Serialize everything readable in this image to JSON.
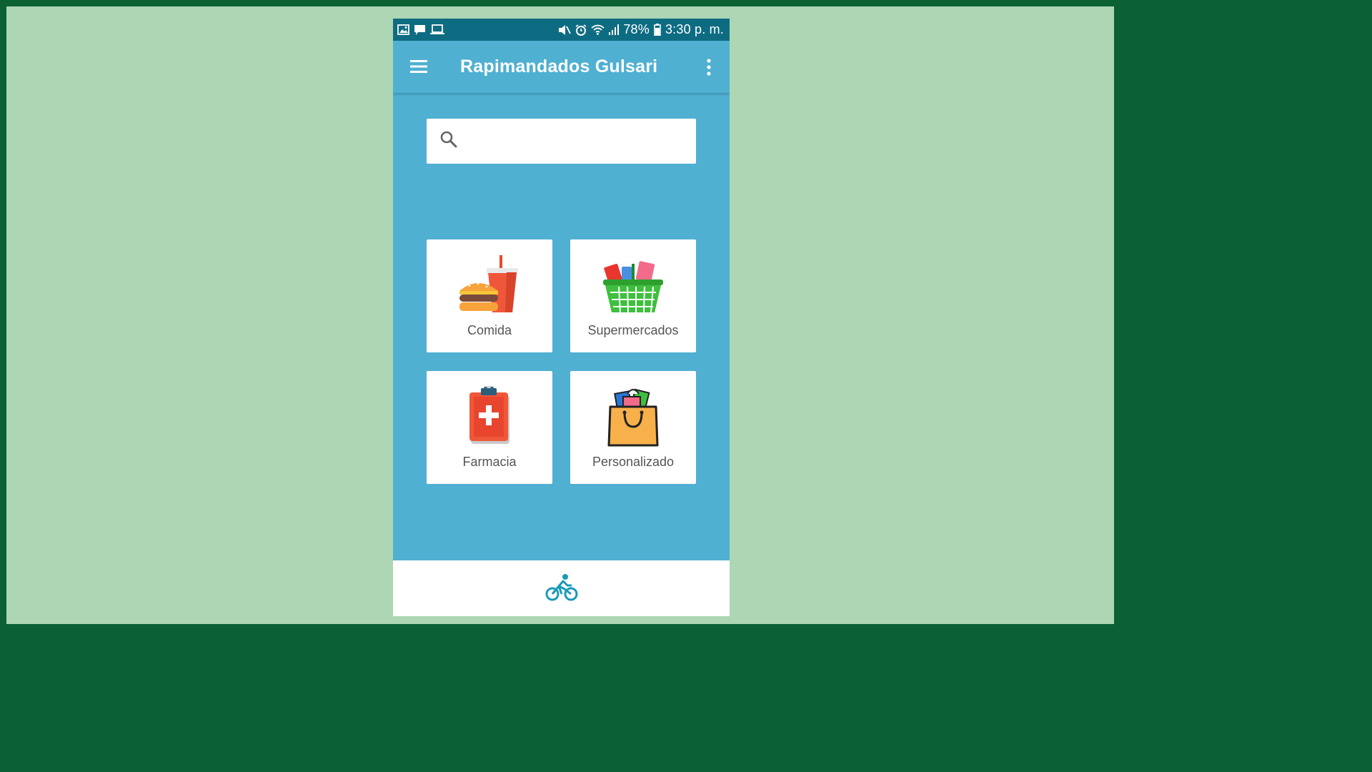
{
  "status_bar": {
    "battery": "78%",
    "time": "3:30 p. m."
  },
  "app_bar": {
    "title": "Rapimandados Gulsari"
  },
  "search": {
    "placeholder": "",
    "value": ""
  },
  "categories": [
    {
      "label": "Comida",
      "icon": "burger-drink-icon"
    },
    {
      "label": "Supermercados",
      "icon": "grocery-basket-icon"
    },
    {
      "label": "Farmacia",
      "icon": "pharmacy-clipboard-icon"
    },
    {
      "label": "Personalizado",
      "icon": "shopping-bag-icon"
    }
  ],
  "bottom_bar": {
    "icon": "bicycle-icon"
  },
  "colors": {
    "status_bar": "#0e6c82",
    "app_background": "#4fb0d2",
    "outer_border": "#0b6134",
    "outer_background": "#add6b4",
    "bike_icon": "#1a9bb8"
  }
}
